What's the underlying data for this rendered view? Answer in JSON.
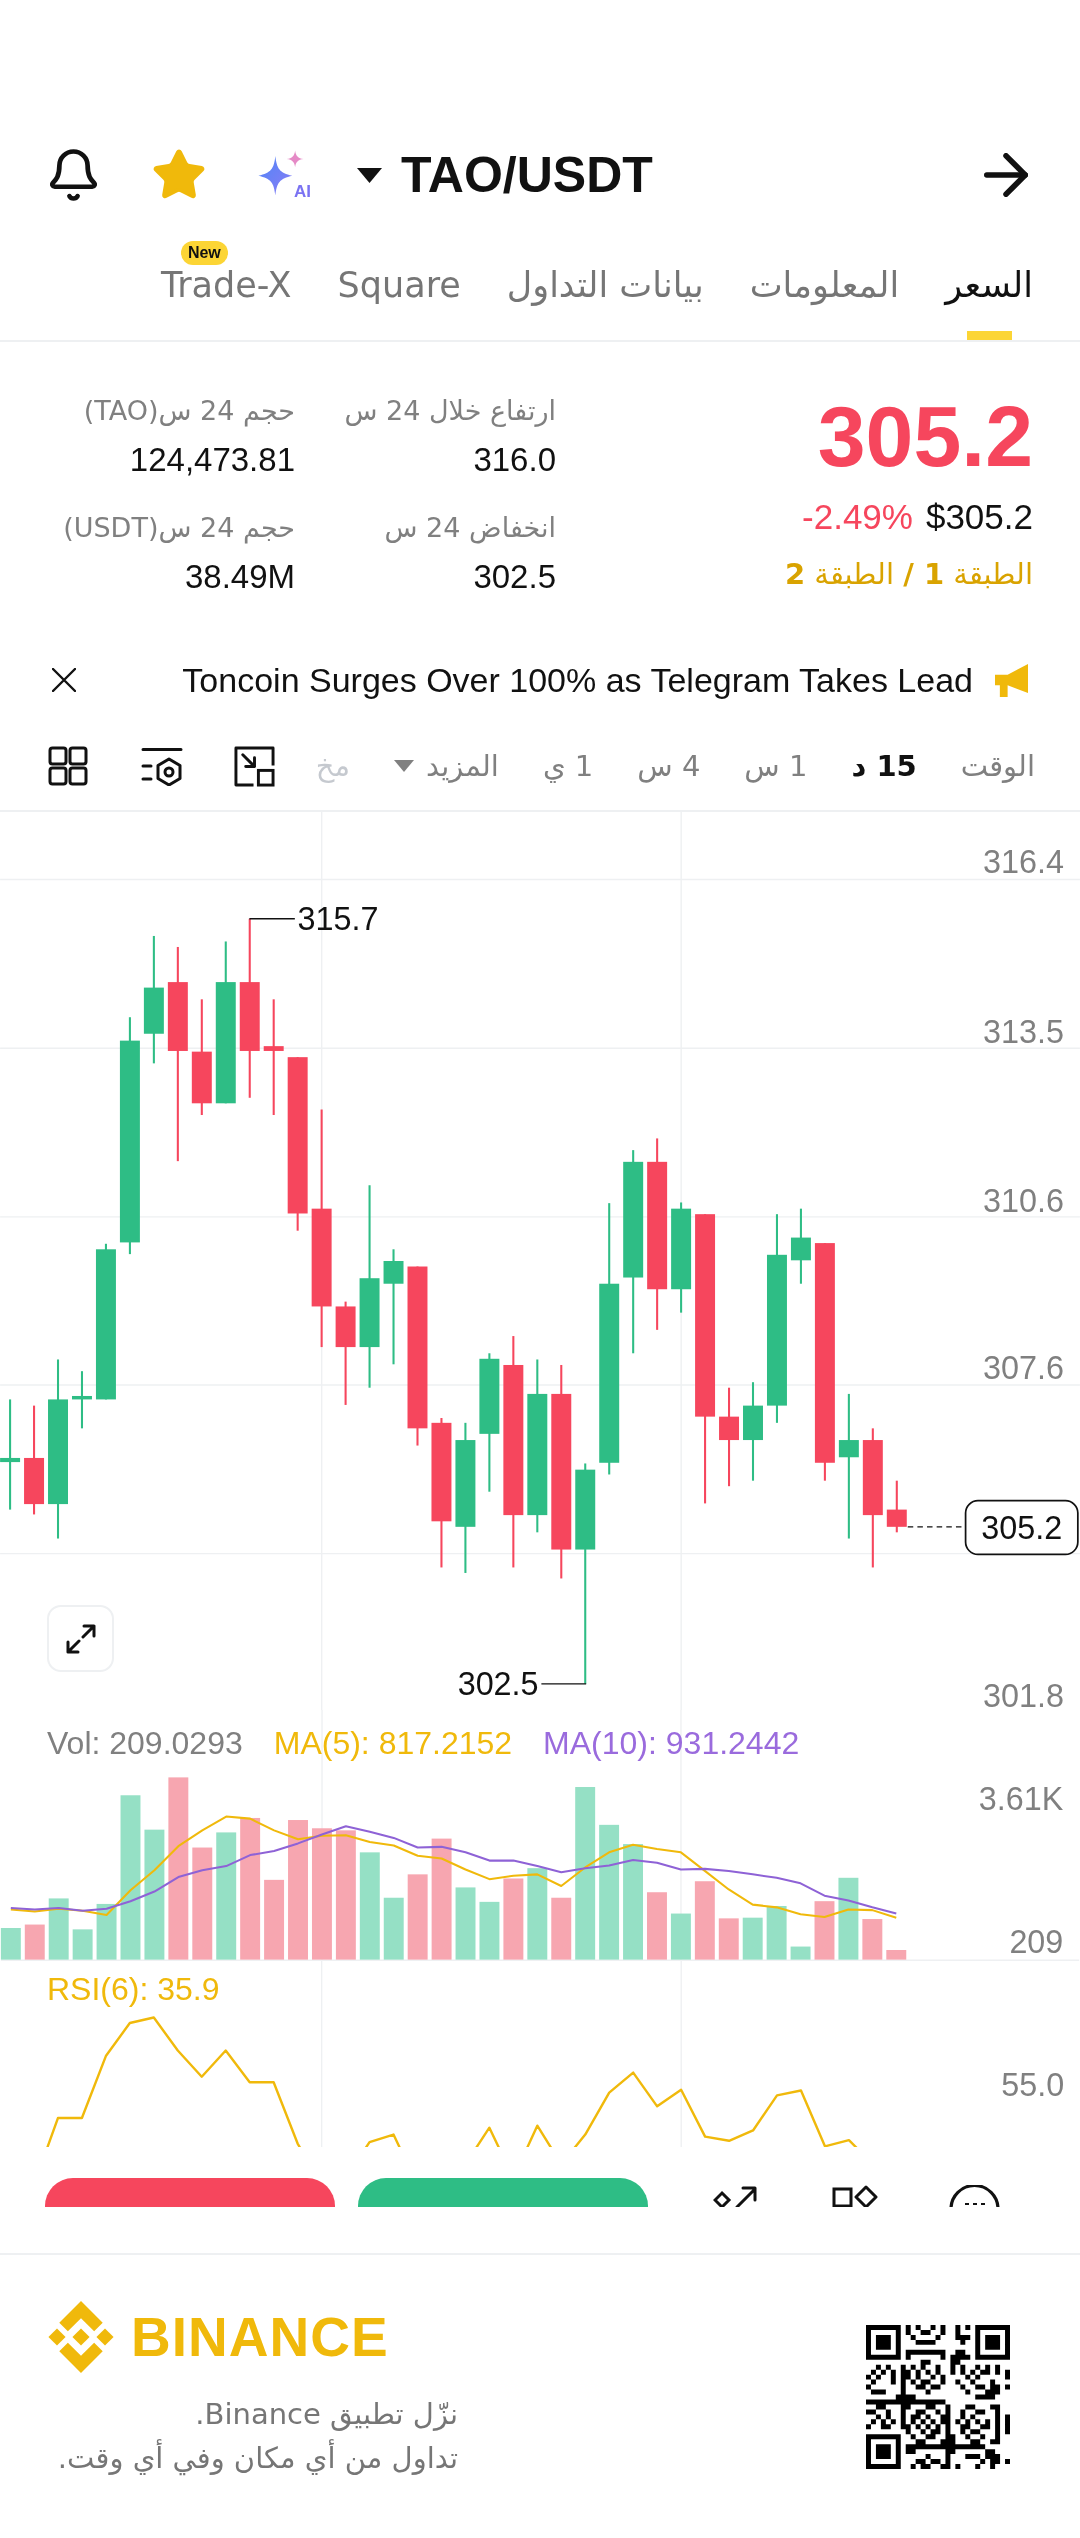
{
  "header": {
    "ai_label": "AI",
    "pair": "TAO/USDT"
  },
  "tabs": [
    {
      "label": "السعر",
      "selected": true
    },
    {
      "label": "المعلومات",
      "selected": false
    },
    {
      "label": "بيانات التداول",
      "selected": false
    },
    {
      "label": "Square",
      "selected": false
    },
    {
      "label": "Trade-X",
      "selected": false,
      "badge": "New"
    }
  ],
  "price": {
    "last": "305.2",
    "change": "-2.49%",
    "usd": "$305.2",
    "layers": "الطبقة **1 /** الطبقة **2**"
  },
  "stats": [
    {
      "label": "ارتفاع خلال 24 س",
      "value": "316.0"
    },
    {
      "label": "حجم 24 س(TAO)",
      "value": "124,473.81"
    },
    {
      "label": "انخفاض 24 س",
      "value": "302.5"
    },
    {
      "label": "حجم 24 س(USDT)",
      "value": "38.49M"
    }
  ],
  "news": {
    "headline": "Toncoin Surges Over 100% as Telegram Takes Lead"
  },
  "timeframes": {
    "label": "الوقت",
    "items": [
      {
        "label": "15 د",
        "selected": true
      },
      {
        "label": "1 س",
        "selected": false
      },
      {
        "label": "4 س",
        "selected": false
      },
      {
        "label": "1 ي",
        "selected": false
      }
    ],
    "more": "المزيد",
    "cut_item": "مخ"
  },
  "chart": {
    "price_axis": [
      "316.4",
      "313.5",
      "310.6",
      "307.6",
      "301.8"
    ],
    "high_marker": "315.7",
    "low_marker": "302.5",
    "current_price": "305.2"
  },
  "volume": {
    "vol": "Vol: 209.0293",
    "ma5": "MA(5): 817.2152",
    "ma10": "MA(10): 931.2442",
    "axis": [
      "3.61K",
      "209"
    ]
  },
  "rsi": {
    "label": "RSI(6): 35.9",
    "axis": "55.0"
  },
  "footer": {
    "brand": "BINANCE",
    "lines": [
      "نزّل تطبيق Binance.",
      "تداول من أي مكان وفي أي وقت."
    ]
  }
}
